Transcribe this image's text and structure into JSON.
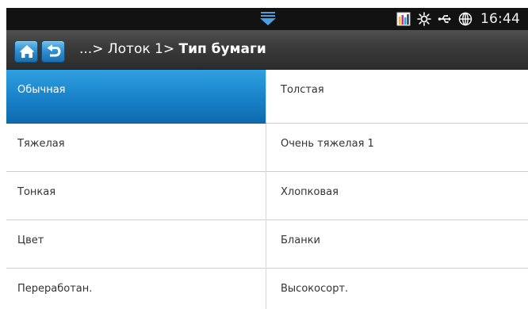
{
  "status_bar": {
    "time": "16:44",
    "icons": [
      "pull-down-tab-icon",
      "toner-level-icon",
      "eco-sun-icon",
      "usb-icon",
      "globe-network-icon"
    ]
  },
  "title_bar": {
    "home_icon": "home-icon",
    "back_icon": "back-arrow-icon",
    "breadcrumb_prefix": "...> Лоток 1> ",
    "breadcrumb_current": "Тип бумаги"
  },
  "options": [
    {
      "label": "Обычная",
      "selected": true
    },
    {
      "label": "Толстая",
      "selected": false
    },
    {
      "label": "Тяжелая",
      "selected": false
    },
    {
      "label": "Очень тяжелая 1",
      "selected": false
    },
    {
      "label": "Тонкая",
      "selected": false
    },
    {
      "label": "Хлопковая",
      "selected": false
    },
    {
      "label": "Цвет",
      "selected": false
    },
    {
      "label": "Бланки",
      "selected": false
    },
    {
      "label": "Переработан.",
      "selected": false
    },
    {
      "label": "Высокосорт.",
      "selected": false
    }
  ],
  "colors": {
    "status_bar_bg": "#121212",
    "title_bar_bg": "#3a3a3a",
    "accent_blue": "#1a84cb",
    "toner_yellow": "#f2c200",
    "toner_magenta": "#d42a8c",
    "toner_cyan": "#22a7e0",
    "toner_black": "#111111"
  }
}
